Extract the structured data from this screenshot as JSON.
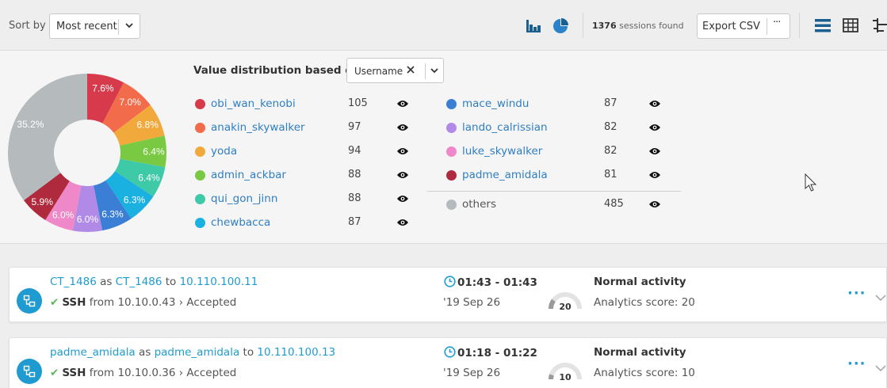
{
  "toolbar": {
    "sort_label": "Sort by",
    "sort_value": "Most recent",
    "sessions_count": "1376",
    "sessions_suffix": " sessions found",
    "export_label": "Export CSV",
    "export_more": "···"
  },
  "distribution": {
    "title": "Value distribution based on",
    "field": "Username",
    "items": [
      {
        "name": "obi_wan_kenobi",
        "count": "105",
        "color": "#d63a4b"
      },
      {
        "name": "anakin_skywalker",
        "count": "97",
        "color": "#f26b4a"
      },
      {
        "name": "yoda",
        "count": "94",
        "color": "#f2a93b"
      },
      {
        "name": "admin_ackbar",
        "count": "88",
        "color": "#7ac943"
      },
      {
        "name": "qui_gon_jinn",
        "count": "88",
        "color": "#3ec9a7"
      },
      {
        "name": "chewbacca",
        "count": "87",
        "color": "#1ab0e0"
      },
      {
        "name": "mace_windu",
        "count": "87",
        "color": "#3a7fd5"
      },
      {
        "name": "lando_calrissian",
        "count": "82",
        "color": "#b08ae6"
      },
      {
        "name": "luke_skywalker",
        "count": "82",
        "color": "#ee88c8"
      },
      {
        "name": "padme_amidala",
        "count": "81",
        "color": "#b02a3e"
      }
    ],
    "others": {
      "name": "others",
      "count": "485",
      "color": "#b5babd"
    }
  },
  "chart_data": {
    "type": "pie",
    "labels": [
      "obi_wan_kenobi",
      "anakin_skywalker",
      "yoda",
      "admin_ackbar",
      "qui_gon_jinn",
      "chewbacca",
      "mace_windu",
      "lando_calrissian",
      "luke_skywalker",
      "padme_amidala",
      "others"
    ],
    "values": [
      105,
      97,
      94,
      88,
      88,
      87,
      87,
      82,
      82,
      81,
      485
    ],
    "percent_labels": [
      "7.6%",
      "7.0%",
      "6.8%",
      "6.4%",
      "6.4%",
      "6.3%",
      "6.3%",
      "6.0%",
      "6.0%",
      "5.9%",
      "35.2%"
    ],
    "colors": [
      "#d63a4b",
      "#f26b4a",
      "#f2a93b",
      "#7ac943",
      "#3ec9a7",
      "#1ab0e0",
      "#3a7fd5",
      "#b08ae6",
      "#ee88c8",
      "#b02a3e",
      "#b5babd"
    ]
  },
  "sessions": [
    {
      "user": "CT_1486",
      "as_word": " as ",
      "account": "CT_1486",
      "to_word": " to ",
      "target": "10.110.100.11",
      "protocol": "SSH",
      "from_text": " from 10.10.0.43 › Accepted",
      "time": "01:43 - 01:43",
      "date": "'19 Sep 26",
      "score_value": "20",
      "score_fraction": 0.2,
      "activity": "Normal activity",
      "score_text": "Analytics score: 20"
    },
    {
      "user": "padme_amidala",
      "as_word": " as ",
      "account": "padme_amidala",
      "to_word": " to ",
      "target": "10.110.100.13",
      "protocol": "SSH",
      "from_text": " from 10.10.0.36 › Accepted",
      "time": "01:18 - 01:22",
      "date": "'19 Sep 26",
      "score_value": "10",
      "score_fraction": 0.1,
      "activity": "Normal activity",
      "score_text": "Analytics score: 10"
    }
  ]
}
